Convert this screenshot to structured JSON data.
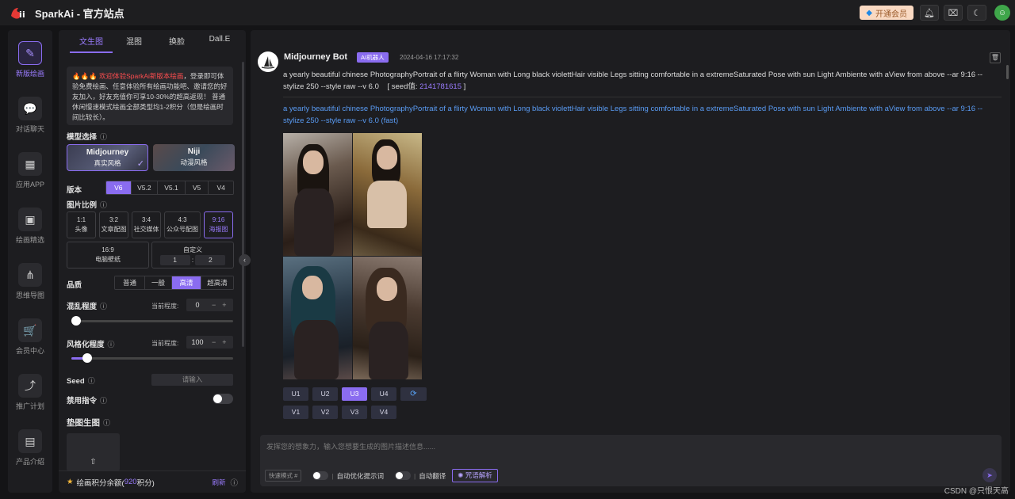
{
  "app": {
    "name": "SparkAi - 官方站点"
  },
  "topbar": {
    "vip_label": "开通会员",
    "icons": [
      "bell-icon",
      "gift-icon",
      "moon-icon"
    ],
    "avatar_initial": "☺"
  },
  "nav": {
    "items": [
      {
        "label": "新版绘画",
        "icon": "✎",
        "active": true
      },
      {
        "label": "对话聊天",
        "icon": "💬"
      },
      {
        "label": "应用APP",
        "icon": "▦"
      },
      {
        "label": "绘画精选",
        "icon": "▣"
      },
      {
        "label": "思维导图",
        "icon": "⋔"
      },
      {
        "label": "会员中心",
        "icon": "🛒"
      },
      {
        "label": "推广计划",
        "icon": "⤴"
      },
      {
        "label": "产品介绍",
        "icon": "▤"
      }
    ]
  },
  "panel": {
    "tabs": [
      "文生图",
      "混图",
      "换脸",
      "Dall.E"
    ],
    "notice_fire": "🔥🔥🔥",
    "notice_red": "欢迎体验SparkAi新版本绘画",
    "notice_text": "，登录即可体验免费绘画、任意体验所有绘画功能吧、邀请您的好友加入，好友充值你可享10-30%的超高返现！ 普通休闲慢速模式绘画全部类型均1-2积分（但是绘画时间比较长）。",
    "model_label": "模型选择",
    "models": [
      {
        "name": "Midjourney",
        "desc": "真实风格"
      },
      {
        "name": "Niji",
        "desc": "动漫风格"
      }
    ],
    "version_label": "版本",
    "versions": [
      "V6",
      "V5.2",
      "V5.1",
      "V5",
      "V4"
    ],
    "ratio_label": "图片比例",
    "ratios": [
      {
        "r": "1:1",
        "d": "头像"
      },
      {
        "r": "3:2",
        "d": "文章配图"
      },
      {
        "r": "3:4",
        "d": "社交媒体"
      },
      {
        "r": "4:3",
        "d": "公众号配图"
      },
      {
        "r": "9:16",
        "d": "海报图"
      }
    ],
    "ratio_wide": {
      "r": "16:9",
      "d": "电脑壁纸"
    },
    "custom": {
      "label": "自定义",
      "w": "1",
      "sep": ":",
      "h": "2"
    },
    "quality_label": "品质",
    "qualities": [
      "普通",
      "一般",
      "高清",
      "超高清"
    ],
    "chaos_label": "混乱程度",
    "stylize_label": "风格化程度",
    "current_label": "当前程度:",
    "chaos_value": "0",
    "chaos_ratio": 0,
    "stylize_value": "100",
    "stylize_ratio": 0.1,
    "seed_label": "Seed",
    "seed_placeholder": "请输入",
    "forbid_label": "禁用指令",
    "pad_label": "垫图生图",
    "upload_icon": "⇧",
    "footer_label": "绘画积分余额(",
    "footer_num": "920",
    "footer_unit": "积分)",
    "refresh_label": "刷新"
  },
  "chat": {
    "bot_name": "Midjourney Bot",
    "bot_badge": "AI机器人",
    "time": "2024-04-16 17:17:32",
    "prompt": "a yearly beautiful chinese PhotographyPortrait of a flirty Woman with Long black violettHair visible Legs sitting comfortable in a extremeSaturated Pose with sun Light Ambiente with aView from above --ar 9:16 --stylize 250 --style raw --v 6.0",
    "seed_label": "[ seed值:",
    "seed_value": "2141781615",
    "seed_close": "]",
    "prompt_fast": "a yearly beautiful chinese PhotographyPortrait of a flirty Woman with Long black violettHair visible Legs sitting comfortable in a extremeSaturated Pose with sun Light Ambiente with aView from above --ar 9:16 --stylize 250 --style raw --v 6.0  (fast)",
    "u_buttons": [
      "U1",
      "U2",
      "U3",
      "U4"
    ],
    "v_buttons": [
      "V1",
      "V2",
      "V3",
      "V4"
    ],
    "refresh_icon": "⟳",
    "input_placeholder": "发挥您的想象力，输入您想要生成的图片描述信息......",
    "quick_mode": "快速模式 #",
    "auto_optimize": "自动优化提示词",
    "auto_translate": "自动翻译",
    "explain": "咒语解析",
    "sep": "|"
  },
  "watermark": "CSDN @只恨天高",
  "colors": {
    "accent": "#8a6cf0",
    "link": "#5a9cf5",
    "warn": "#ff4d4f"
  }
}
